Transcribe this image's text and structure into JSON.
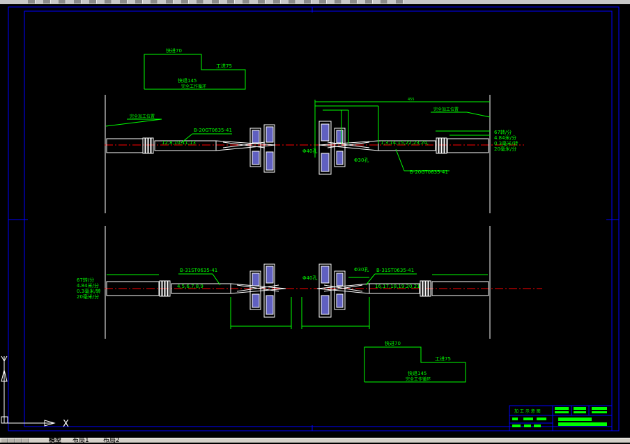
{
  "app": {
    "toolbar_icons": [
      "new-icon",
      "open-icon",
      "save-icon",
      "print-icon",
      "preview-icon",
      "cut-icon",
      "copy-icon",
      "paste-icon",
      "matchprop-icon",
      "undo-icon",
      "redo-icon",
      "pan-icon",
      "zoom-realtime-icon",
      "zoom-window-icon",
      "zoom-previous-icon",
      "properties-icon",
      "designcenter-icon",
      "toolpalette-icon",
      "sheetset-icon",
      "markup-icon",
      "calc-icon",
      "help-icon",
      "layer-icon",
      "layer-state-icon",
      "color-icon"
    ]
  },
  "layout_tabs": {
    "model": "模型",
    "layout1": "布局1",
    "layout2": "布局2"
  },
  "ucs": {
    "x": "X",
    "y": "Y"
  },
  "top_diagram": {
    "legend": {
      "speed70": "快进70",
      "work75": "工进75",
      "total145": "快退145",
      "total_note": "完全工作循环"
    },
    "left_head_label": "B-20GT0635-41",
    "left_spindle_nums": "12,8,10,11,13",
    "left_line_note": "完全加工位置",
    "right_head_label": "B-20GT0635-41",
    "right_spindle_nums": "1,3,14,15,22,23,24,",
    "right_line_note": "完全加工位置",
    "dia40": "Φ40孔",
    "dia30": "Φ30孔",
    "dim_top": "455",
    "speeds": [
      "67转/分",
      "4.84米/分",
      "0.3毫米/转",
      "20毫米/分"
    ]
  },
  "bottom_diagram": {
    "left_head_label": "B-31ST0635-41",
    "left_spindle_nums": "4,5,6,7,8,9",
    "right_head_label": "B-31ST0635-41",
    "right_spindle_nums": "16,17,18,19,20,21",
    "dia40": "Φ40孔",
    "dia30": "Φ30孔",
    "speeds": [
      "67转/分",
      "4.84米/分",
      "0.3毫米/转",
      "20毫米/分"
    ],
    "legend": {
      "speed70": "快进70",
      "work75": "工进75",
      "total145": "快退145",
      "total_note": "完全工作循环"
    }
  },
  "title_block": {
    "heading": "加 工 示 意 图"
  },
  "colors": {
    "background": "#000000",
    "frame": "#0000ff",
    "dim": "#00ff00",
    "part": "#ffffff",
    "center": "#ff0000",
    "fixture": "#6060c0"
  }
}
